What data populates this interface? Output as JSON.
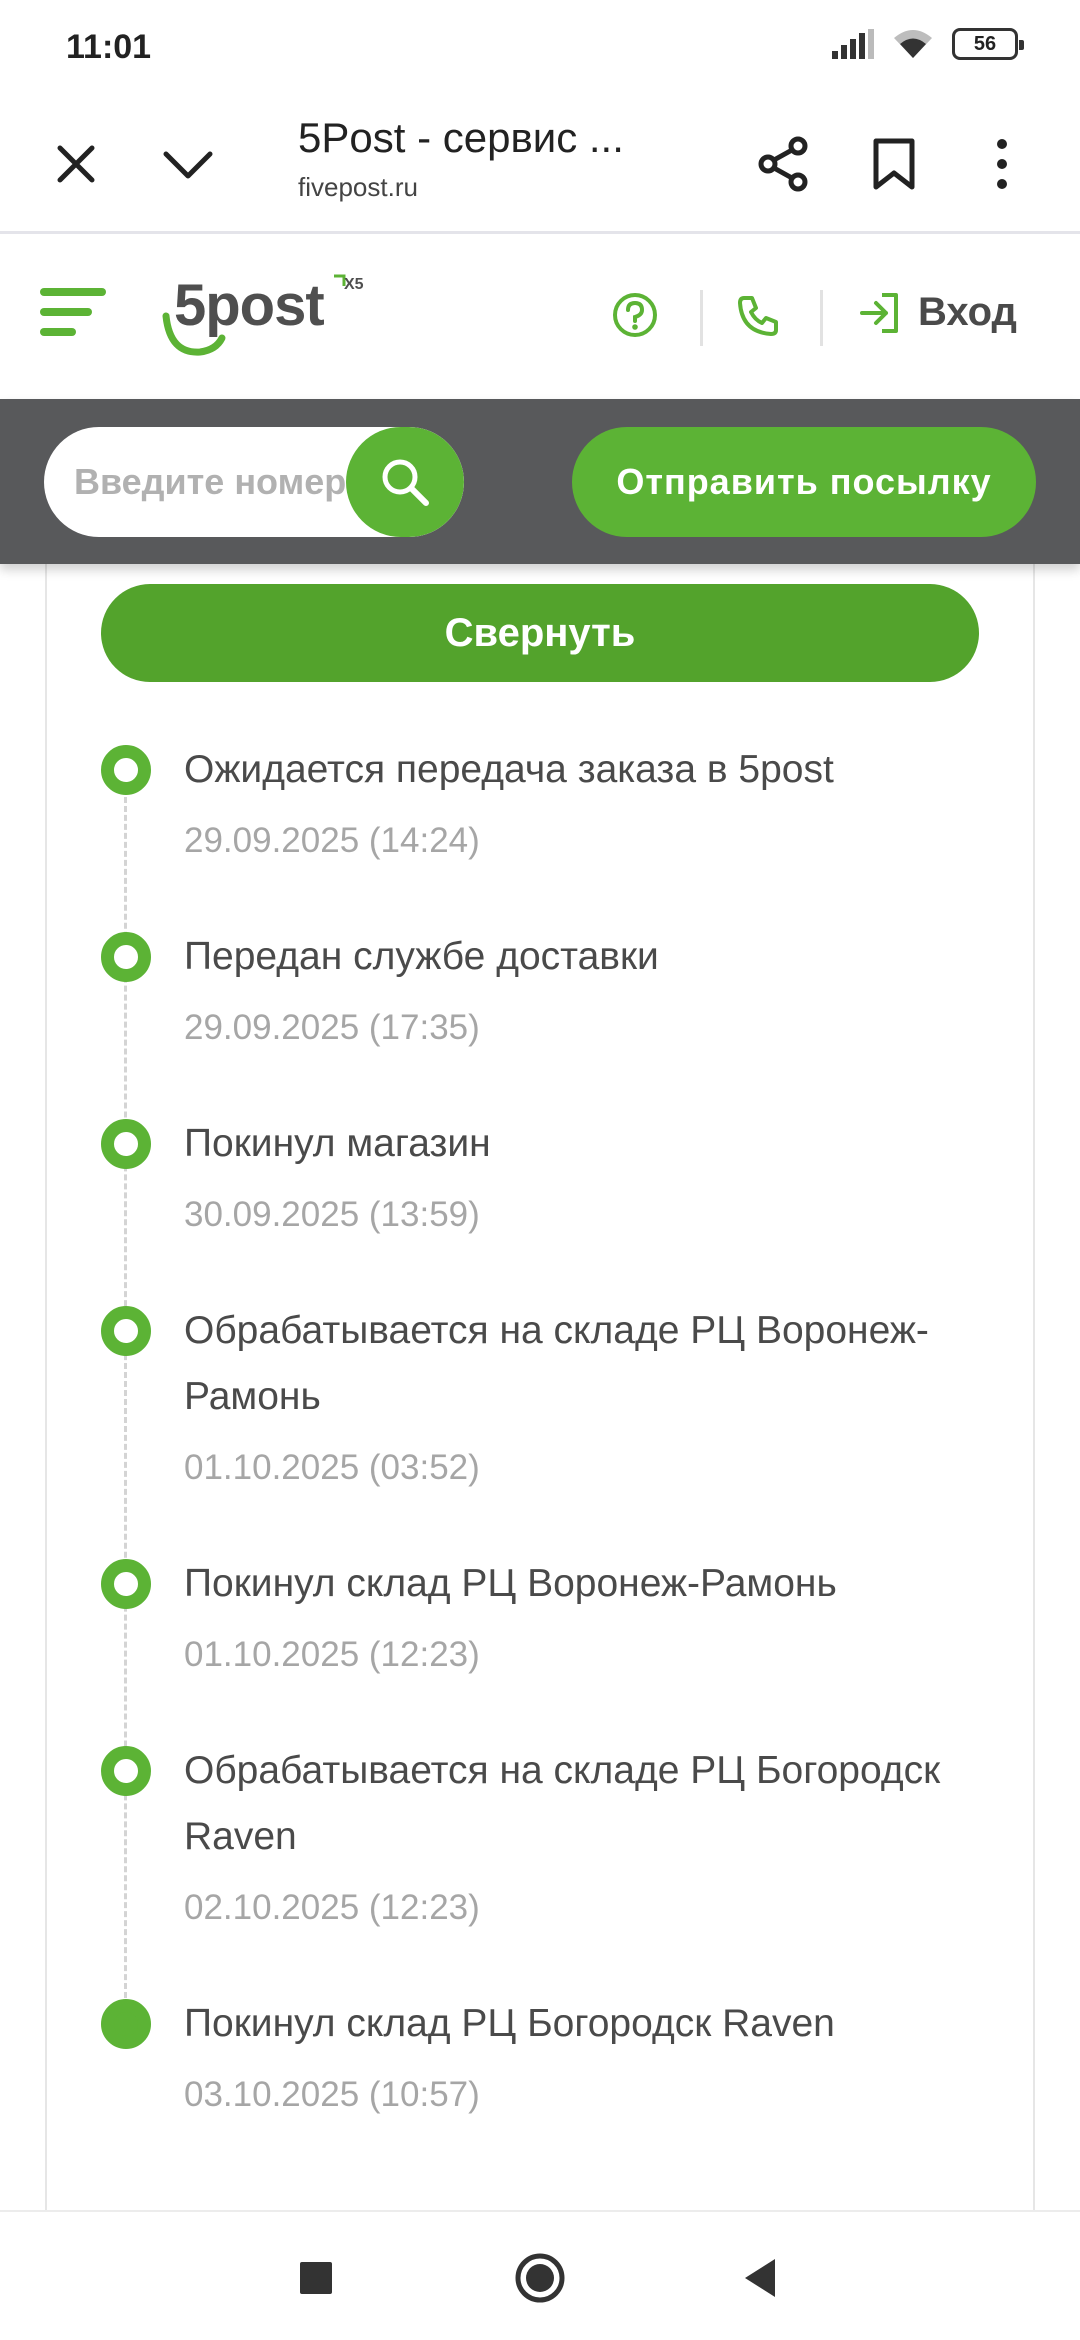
{
  "status_bar": {
    "time": "11:01",
    "battery": "56"
  },
  "browser": {
    "title": "5Post - сервис ...",
    "url": "fivepost.ru"
  },
  "header": {
    "logo_text": "5post",
    "logo_badge": "X5",
    "login_label": "Вход"
  },
  "search": {
    "placeholder": "Введите номер",
    "send_button": "Отправить посылку"
  },
  "collapse_button": "Свернуть",
  "timeline": [
    {
      "title": "Ожидается передача заказа в 5post",
      "date": "29.09.2025 (14:24)"
    },
    {
      "title": "Передан службе доставки",
      "date": "29.09.2025 (17:35)"
    },
    {
      "title": "Покинул магазин",
      "date": "30.09.2025 (13:59)"
    },
    {
      "title": "Обрабатывается на складе РЦ Воронеж-Рамонь",
      "date": "01.10.2025 (03:52)"
    },
    {
      "title": "Покинул склад РЦ Воронеж-Рамонь",
      "date": "01.10.2025 (12:23)"
    },
    {
      "title": "Обрабатывается на складе РЦ Богородск Raven",
      "date": "02.10.2025 (12:23)"
    },
    {
      "title": "Покинул склад РЦ Богородск Raven",
      "date": "03.10.2025 (10:57)"
    }
  ],
  "colors": {
    "brand_green": "#5cb335",
    "dark_green": "#53a32c",
    "band_gray": "#58595b"
  },
  "icons": {
    "browser": [
      "close-icon",
      "chevron-down-icon",
      "share-icon",
      "bookmark-icon",
      "more-vert-icon"
    ],
    "header": [
      "menu-icon",
      "help-icon",
      "phone-icon",
      "login-icon"
    ],
    "nav": [
      "recents-icon",
      "home-icon",
      "back-icon"
    ]
  }
}
